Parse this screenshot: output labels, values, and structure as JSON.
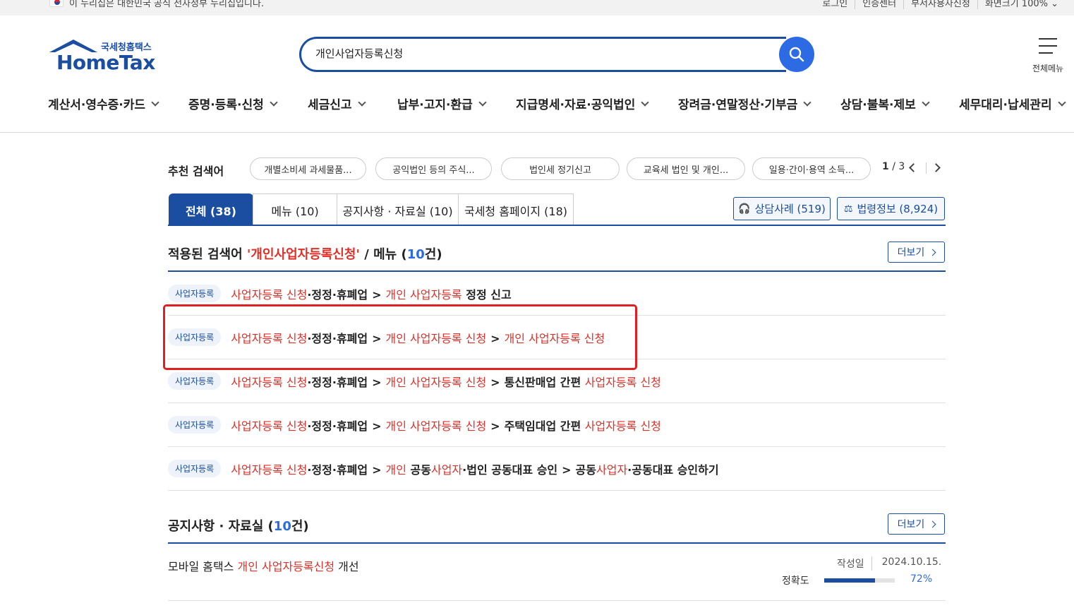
{
  "gov_banner": {
    "text": "이 누리집은 대한민국 공식 전자정부 누리집입니다."
  },
  "util_links": [
    "로그인",
    "인증센터",
    "부서사용자신청",
    "화면크기 100% ⌄"
  ],
  "logo": {
    "sub": "국세청홈택스",
    "main": "HomeTax"
  },
  "search": {
    "value": "개인사업자등록신청",
    "button_icon": "search-icon"
  },
  "all_menu": {
    "label": "전체메뉴"
  },
  "gnb": [
    "계산서·영수증·카드",
    "증명·등록·신청",
    "세금신고",
    "납부·고지·환급",
    "지급명세·자료·공익법인",
    "장려금·연말정산·기부금",
    "상담·불복·제보",
    "세무대리·납세관리"
  ],
  "recommended": {
    "title": "추천 검색어",
    "chips": [
      "개별소비세 과세물품...",
      "공익법인 등의 주식...",
      "법인세 정기신고",
      "교육세 법인 및 개인...",
      "일용·간이·용역 소득..."
    ],
    "page_current": "1",
    "page_total": "/ 3"
  },
  "tabs": [
    "전체 (38)",
    "메뉴 (10)",
    "공지사항 · 자료실 (10)",
    "국세청 홈페이지 (18)"
  ],
  "side_buttons": {
    "consult": "상담사례 (519)",
    "law": "법령정보 (8,924)"
  },
  "menu_section": {
    "prefix": "적용된 검색어 ",
    "keyword": "'개인사업자등록신청'",
    "middle": " / 메뉴 (",
    "count": "10",
    "suffix": "건)",
    "more": "더보기"
  },
  "results": [
    {
      "badge": "사업자등록",
      "segments": [
        [
          "r",
          "사업자등록 신청"
        ],
        [
          "b",
          "·정정·휴폐업"
        ],
        [
          "s",
          ">"
        ],
        [
          "r",
          "개인 사업자등록"
        ],
        [
          "b",
          " 정정 신고"
        ]
      ]
    },
    {
      "badge": "사업자등록",
      "segments": [
        [
          "r",
          "사업자등록 신청"
        ],
        [
          "b",
          "·정정·휴폐업"
        ],
        [
          "s",
          ">"
        ],
        [
          "r",
          "개인 사업자등록 신청"
        ],
        [
          "s",
          ">"
        ],
        [
          "r",
          "개인 사업자등록 신청"
        ]
      ]
    },
    {
      "badge": "사업자등록",
      "segments": [
        [
          "r",
          "사업자등록 신청"
        ],
        [
          "b",
          "·정정·휴폐업"
        ],
        [
          "s",
          ">"
        ],
        [
          "r",
          "개인 사업자등록 신청"
        ],
        [
          "s",
          ">"
        ],
        [
          "b",
          "통신판매업 간편 "
        ],
        [
          "r",
          "사업자등록 신청"
        ]
      ]
    },
    {
      "badge": "사업자등록",
      "segments": [
        [
          "r",
          "사업자등록 신청"
        ],
        [
          "b",
          "·정정·휴폐업"
        ],
        [
          "s",
          ">"
        ],
        [
          "r",
          "개인 사업자등록 신청"
        ],
        [
          "s",
          ">"
        ],
        [
          "b",
          "주택임대업 간편 "
        ],
        [
          "r",
          "사업자등록 신청"
        ]
      ]
    },
    {
      "badge": "사업자등록",
      "segments": [
        [
          "r",
          "사업자등록 신청"
        ],
        [
          "b",
          "·정정·휴폐업"
        ],
        [
          "s",
          ">"
        ],
        [
          "r",
          "개인"
        ],
        [
          "b",
          " 공동"
        ],
        [
          "r",
          "사업자"
        ],
        [
          "b",
          "·법인 공동대표 승인"
        ],
        [
          "s",
          ">"
        ],
        [
          "b",
          "공동"
        ],
        [
          "r",
          "사업자"
        ],
        [
          "b",
          "·공동대표 승인하기"
        ]
      ]
    }
  ],
  "notice_section": {
    "prefix": "공지사항 · 자료실 (",
    "count": "10",
    "suffix": "건)",
    "more": "더보기"
  },
  "notice": {
    "title_pre": "모바일 홈택스 ",
    "title_hl": "개인 사업자등록신청",
    "title_post": " 개선",
    "date_label": "작성일",
    "date": "2024.10.15.",
    "accuracy_label": "정확도",
    "accuracy": "72%",
    "accuracy_value": 0.72
  },
  "colors": {
    "brand": "#1b4ea0",
    "accent": "#2d6be4",
    "highlight": "#e0302a"
  }
}
